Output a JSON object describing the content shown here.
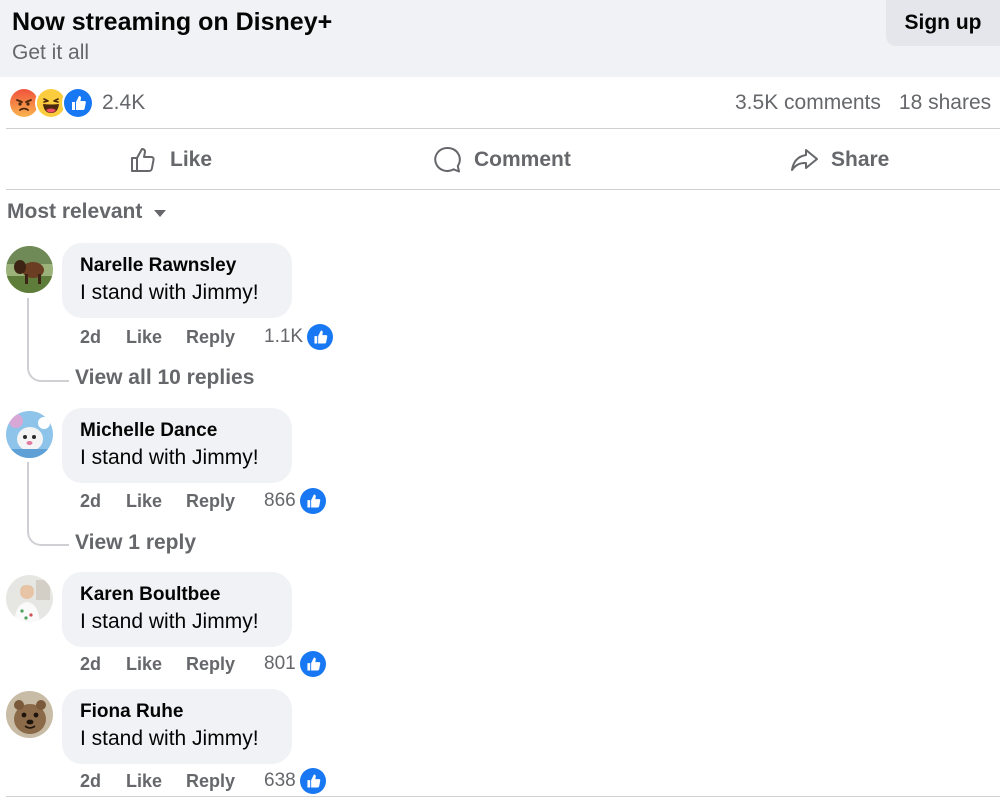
{
  "banner": {
    "title": "Now streaming on Disney+",
    "subtitle": "Get it all",
    "signup_label": "Sign up"
  },
  "reactions": {
    "icons": [
      "angry-icon",
      "haha-icon",
      "like-icon"
    ],
    "count": "2.4K",
    "comments": "3.5K comments",
    "shares": "18 shares"
  },
  "actions": {
    "like": "Like",
    "comment": "Comment",
    "share": "Share"
  },
  "sort": {
    "label": "Most relevant"
  },
  "colors": {
    "like_blue": "#1877f2",
    "secondary_text": "#65676b",
    "bubble_bg": "#f0f2f5"
  },
  "comments": [
    {
      "name": "Narelle Rawnsley",
      "text": "I stand with Jimmy!",
      "time": "2d",
      "like": "Like",
      "reply": "Reply",
      "count": "1.1K",
      "replies_link": "View all 10 replies"
    },
    {
      "name": "Michelle Dance",
      "text": "I stand with Jimmy!",
      "time": "2d",
      "like": "Like",
      "reply": "Reply",
      "count": "866",
      "replies_link": "View 1 reply"
    },
    {
      "name": "Karen Boultbee",
      "text": "I stand with Jimmy!",
      "time": "2d",
      "like": "Like",
      "reply": "Reply",
      "count": "801"
    },
    {
      "name": "Fiona Ruhe",
      "text": "I stand with Jimmy!",
      "time": "2d",
      "like": "Like",
      "reply": "Reply",
      "count": "638"
    }
  ]
}
